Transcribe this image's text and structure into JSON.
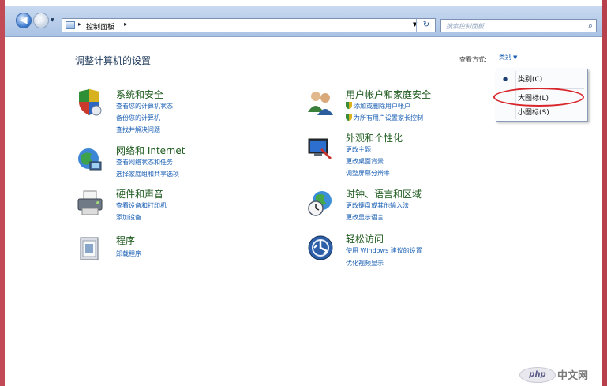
{
  "addressbar": {
    "crumb": "控制面板",
    "separator": "▸"
  },
  "search": {
    "placeholder": "搜索控制面板"
  },
  "nav": {
    "back": "◀",
    "forward": "▶",
    "history": "▼",
    "refresh": "↻"
  },
  "page": {
    "title": "调整计算机的设置"
  },
  "viewby": {
    "label": "查看方式:",
    "selected": "类别",
    "options": [
      "类别(C)",
      "大图标(L)",
      "小图标(S)"
    ],
    "highlighted_option": "大图标(L)"
  },
  "categories_left": [
    {
      "title": "系统和安全",
      "icon": "shield-icon",
      "links": [
        "查看您的计算机状态",
        "备份您的计算机",
        "查找并解决问题"
      ]
    },
    {
      "title": "网络和 Internet",
      "icon": "network-globe-icon",
      "links": [
        "查看网络状态和任务",
        "选择家庭组和共享选项"
      ]
    },
    {
      "title": "硬件和声音",
      "icon": "printer-icon",
      "links": [
        "查看设备和打印机",
        "添加设备"
      ]
    },
    {
      "title": "程序",
      "icon": "programs-icon",
      "links": [
        "卸载程序"
      ]
    }
  ],
  "categories_right": [
    {
      "title": "用户帐户和家庭安全",
      "icon": "users-icon",
      "links": [
        "添加或删除用户帐户",
        "为所有用户设置家长控制"
      ]
    },
    {
      "title": "外观和个性化",
      "icon": "monitor-paint-icon",
      "links": [
        "更改主题",
        "更改桌面背景",
        "调整屏幕分辨率"
      ]
    },
    {
      "title": "时钟、语言和区域",
      "icon": "clock-globe-icon",
      "links": [
        "更改键盘或其他输入法",
        "更改显示语言"
      ]
    },
    {
      "title": "轻松访问",
      "icon": "ease-of-access-icon",
      "links": [
        "使用 Windows 建议的设置",
        "优化视频显示"
      ]
    }
  ],
  "watermark": {
    "logo": "php",
    "text": "中文网"
  },
  "colors": {
    "accent_link": "#1a5fb4",
    "category_title": "#1e5a1e",
    "highlight_oval": "#d8262b",
    "frame": "#c24a57"
  }
}
